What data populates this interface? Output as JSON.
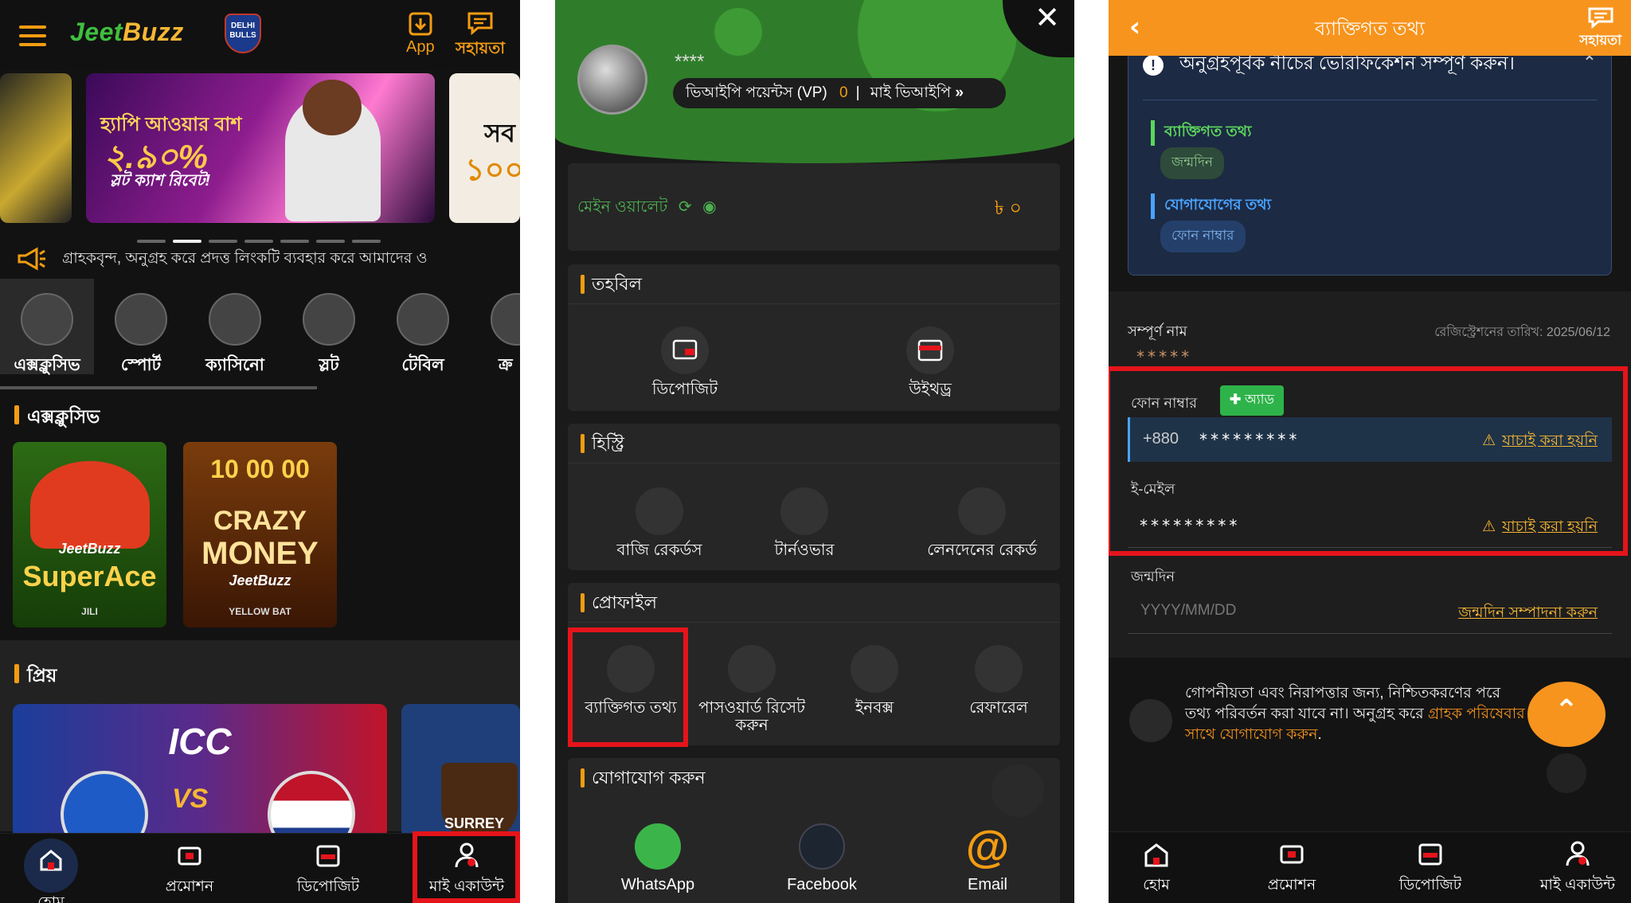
{
  "panel1": {
    "logo": {
      "text_a": "Jeet",
      "text_b": "Buzz",
      "badge": "DELHI BULLS"
    },
    "app_label": "App",
    "help_label": "সহায়তা",
    "banner": {
      "line1": "হ্যাপি আওয়ার বাশ",
      "line2": "২.৯০%",
      "line3": "স্লট ক্যাশ রিবেট!",
      "side_text1": "সব",
      "side_text2": "১০০"
    },
    "marquee": "গ্রাহকবৃন্দ, অনুগ্রহ করে প্রদত্ত লিংকটি ব্যবহার করে আমাদের ও",
    "categories": [
      {
        "label": "এক্সক্লুসিভ"
      },
      {
        "label": "স্পোর্ট"
      },
      {
        "label": "ক্যাসিনো"
      },
      {
        "label": "স্লট"
      },
      {
        "label": "টেবিল"
      },
      {
        "label": "ক্র"
      }
    ],
    "section_exclusive": "এক্সক্লুসিভ",
    "games": [
      {
        "title_a": "Super",
        "title_b": "Ace",
        "brand": "JeetBuzz",
        "provider": "JILI"
      },
      {
        "title_a": "CRAZY",
        "title_b": "MONEY",
        "top": "10 00 00",
        "brand": "JeetBuzz",
        "provider": "YELLOW BAT"
      }
    ],
    "section_fav": "প্রিয়",
    "fav_card": {
      "title": "ICC",
      "vs": "VS",
      "side_label": "SURREY"
    },
    "bottom_nav": [
      "হোম",
      "প্রমোশন",
      "ডিপোজিট",
      "মাই একাউন্ট"
    ]
  },
  "panel2": {
    "username": "****",
    "vip_label": "ভিআইপি পয়েন্টস (VP)",
    "vip_points": "0",
    "my_vip": "মাই ভিআইপি",
    "wallet_label": "মেইন ওয়ালেট",
    "wallet_amount": "৳ ০",
    "fund": {
      "title": "তহবিল",
      "items": [
        "ডিপোজিট",
        "উইথড্র"
      ]
    },
    "history": {
      "title": "হিস্ট্রি",
      "items": [
        "বাজি রেকর্ডস",
        "টার্নওভার",
        "লেনদেনের রেকর্ড"
      ]
    },
    "profile": {
      "title": "প্রোফাইল",
      "items": [
        "ব্যাক্তিগত তথ্য",
        "পাসওয়ার্ড রিসেট করুন",
        "ইনবক্স",
        "রেফারেল"
      ]
    },
    "contact": {
      "title": "যোগাযোগ করুন",
      "items": [
        "WhatsApp",
        "Facebook",
        "Email"
      ]
    }
  },
  "panel3": {
    "title": "ব্যাক্তিগত তথ্য",
    "help_label": "সহায়তা",
    "verify_notice": "অনুগ্রহপূর্বক নীচের ভেরিফিকেশন সম্পূর্ণ করুন।",
    "personal_info": "ব্যাক্তিগত তথ্য",
    "dob_tag": "জন্মদিন",
    "contact_info": "যোগাযোগের তথ্য",
    "phone_tag": "ফোন নাম্বার",
    "fullname_label": "সম্পূর্ণ নাম",
    "reg_date": "রেজিস্ট্রেশনের তারিখ: 2025/06/12",
    "fullname_value": "*****",
    "phone_label": "ফোন নাম্বার",
    "add_label": "অ্যাড",
    "country_code": "+880",
    "phone_value": "*********",
    "not_verified": "যাচাই করা হয়নি",
    "email_label": "ই-মেইল",
    "email_value": "*********",
    "dob_label": "জন্মদিন",
    "dob_placeholder": "YYYY/MM/DD",
    "dob_edit": "জন্মদিন সম্পাদনা করুন",
    "privacy_text": "গোপনীয়তা এবং নিরাপত্তার জন্য, নিশ্চিতকরণের পরে তথ্য পরিবর্তন করা যাবে না। অনুগ্রহ করে",
    "privacy_link": "গ্রাহক পরিষেবার সাথে যোগাযোগ করুন",
    "privacy_end": ".",
    "bottom_nav": [
      "হোম",
      "প্রমোশন",
      "ডিপোজিট",
      "মাই একাউন্ট"
    ]
  },
  "colors": {
    "accent": "#f7941d",
    "green": "#2f7d2a",
    "highlight": "#e5141b",
    "link": "#f7b733"
  }
}
